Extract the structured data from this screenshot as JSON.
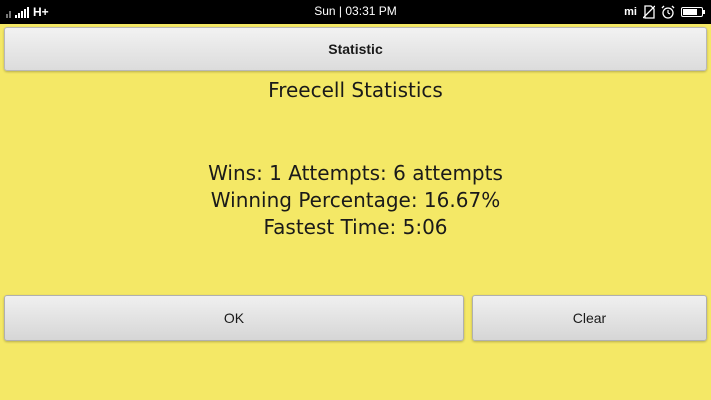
{
  "status_bar": {
    "network": "H+",
    "time": "Sun | 03:31 PM",
    "carrier_logo": "mi",
    "icons": [
      "signal-icon",
      "network-type-icon",
      "mi-icon",
      "no-sim-icon",
      "alarm-icon",
      "battery-icon"
    ]
  },
  "title_bar": {
    "title": "Statistic"
  },
  "main": {
    "heading": "Freecell Statistics",
    "wins_line": "Wins: 1 Attempts: 6 attempts",
    "percentage_line": "Winning Percentage: 16.67%",
    "fastest_line": "Fastest Time: 5:06"
  },
  "buttons": {
    "ok_label": "OK",
    "clear_label": "Clear"
  },
  "colors": {
    "background": "#f4e866",
    "status_bar": "#000000",
    "button": "#e6e6e6"
  }
}
